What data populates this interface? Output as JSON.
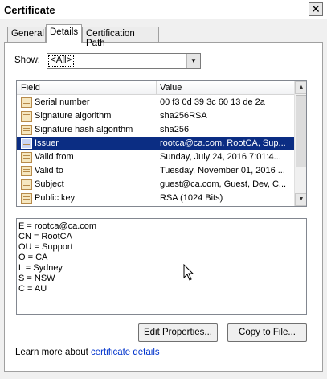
{
  "window": {
    "title": "Certificate",
    "close_glyph": "✕"
  },
  "tabs": [
    {
      "label": "General",
      "active": false
    },
    {
      "label": "Details",
      "active": true
    },
    {
      "label": "Certification Path",
      "active": false
    }
  ],
  "show": {
    "label": "Show:",
    "selected": "<All>"
  },
  "fields_table": {
    "columns": [
      "Field",
      "Value"
    ],
    "rows": [
      {
        "field": "Serial number",
        "value": "00 f3 0d 39 3c 60 13 de 2a",
        "selected": false
      },
      {
        "field": "Signature algorithm",
        "value": "sha256RSA",
        "selected": false
      },
      {
        "field": "Signature hash algorithm",
        "value": "sha256",
        "selected": false
      },
      {
        "field": "Issuer",
        "value": "rootca@ca.com, RootCA, Sup...",
        "selected": true
      },
      {
        "field": "Valid from",
        "value": "Sunday, July 24, 2016 7:01:4...",
        "selected": false
      },
      {
        "field": "Valid to",
        "value": "Tuesday, November 01, 2016 ...",
        "selected": false
      },
      {
        "field": "Subject",
        "value": "guest@ca.com, Guest, Dev, C...",
        "selected": false
      },
      {
        "field": "Public key",
        "value": "RSA (1024 Bits)",
        "selected": false
      }
    ]
  },
  "detail_lines": [
    "E = rootca@ca.com",
    "CN = RootCA",
    "OU = Support",
    "O = CA",
    "L = Sydney",
    "S = NSW",
    "C = AU"
  ],
  "buttons": {
    "edit_properties": "Edit Properties...",
    "copy_to_file": "Copy to File..."
  },
  "footer": {
    "learn_prefix": "Learn more about ",
    "learn_link": "certificate details"
  },
  "colors": {
    "selection": "#0b2d83",
    "link": "#0033cc"
  }
}
